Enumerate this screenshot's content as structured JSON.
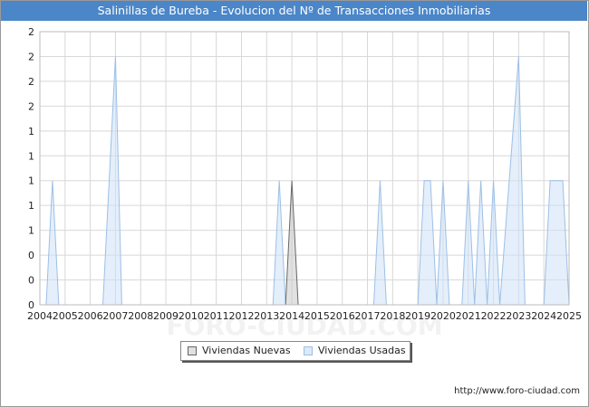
{
  "title": "Salinillas de Bureba - Evolucion del Nº de Transacciones Inmobiliarias",
  "source_url": "http://www.foro-ciudad.com",
  "watermark": "FORO-CIUDAD.COM",
  "legend": [
    {
      "label": "Viviendas Nuevas",
      "color": "#e0e0e0",
      "stroke": "#666666"
    },
    {
      "label": "Viviendas Usadas",
      "color": "#dce9f7",
      "stroke": "#9dbfe6"
    }
  ],
  "chart_data": {
    "type": "area",
    "x_ticks": [
      "2004",
      "2005",
      "2006",
      "2007",
      "2008",
      "2009",
      "2010",
      "2011",
      "2012",
      "2013",
      "2014",
      "2015",
      "2016",
      "2017",
      "2018",
      "2019",
      "2020",
      "2021",
      "2022",
      "2023",
      "2024",
      "2025"
    ],
    "y_tick_labels": [
      "0",
      "0",
      "0",
      "1",
      "1",
      "1",
      "1",
      "1",
      "2",
      "2",
      "2",
      "2"
    ],
    "ylim": [
      0,
      2.2
    ],
    "grid": true,
    "legend_position": "bottom",
    "series": [
      {
        "name": "Viviendas Nuevas",
        "points": [
          [
            2013.75,
            0
          ],
          [
            2014.0,
            1
          ],
          [
            2014.25,
            0
          ]
        ]
      },
      {
        "name": "Viviendas Usadas",
        "points": [
          [
            2004.25,
            0
          ],
          [
            2004.5,
            1
          ],
          [
            2004.75,
            0
          ],
          [
            2006.5,
            0
          ],
          [
            2007.0,
            2
          ],
          [
            2007.25,
            0
          ],
          [
            2013.25,
            0
          ],
          [
            2013.5,
            1
          ],
          [
            2013.75,
            0
          ],
          [
            2017.25,
            0
          ],
          [
            2017.5,
            1
          ],
          [
            2017.75,
            0
          ],
          [
            2019.0,
            0
          ],
          [
            2019.25,
            1
          ],
          [
            2019.5,
            1
          ],
          [
            2019.75,
            0
          ],
          [
            2020.0,
            1
          ],
          [
            2020.25,
            0
          ],
          [
            2020.75,
            0
          ],
          [
            2021.0,
            1
          ],
          [
            2021.25,
            0
          ],
          [
            2021.5,
            1
          ],
          [
            2021.75,
            0
          ],
          [
            2022.0,
            1
          ],
          [
            2022.25,
            0
          ],
          [
            2023.0,
            2
          ],
          [
            2023.25,
            0
          ],
          [
            2024.0,
            0
          ],
          [
            2024.25,
            1
          ],
          [
            2024.75,
            1
          ],
          [
            2025.0,
            0
          ]
        ]
      }
    ]
  }
}
